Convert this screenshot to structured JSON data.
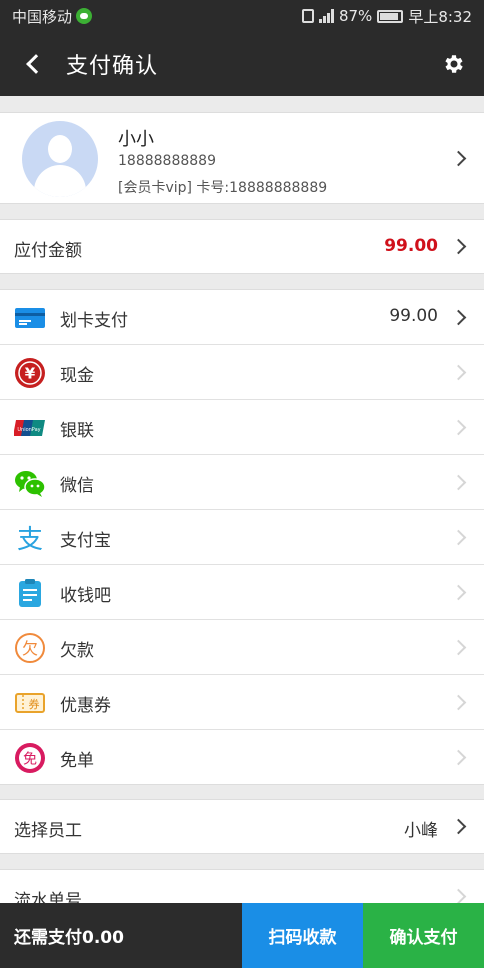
{
  "status_bar": {
    "carrier": "中国移动",
    "battery": "87%",
    "time": "早上8:32"
  },
  "header": {
    "title": "支付确认"
  },
  "member": {
    "name": "小小",
    "phone": "18888888889",
    "card_info": "[会员卡vip] 卡号:18888888889"
  },
  "amount_due": {
    "label": "应付金额",
    "value": "99.00",
    "color": "#d0111b"
  },
  "payment_methods": [
    {
      "label": "划卡支付",
      "value": "99.00",
      "icon": "card-icon"
    },
    {
      "label": "现金",
      "value": "",
      "icon": "cash-yen-icon"
    },
    {
      "label": "银联",
      "value": "",
      "icon": "unionpay-icon"
    },
    {
      "label": "微信",
      "value": "",
      "icon": "wechat-icon"
    },
    {
      "label": "支付宝",
      "value": "",
      "icon": "alipay-icon"
    },
    {
      "label": "收钱吧",
      "value": "",
      "icon": "clipboard-icon"
    },
    {
      "label": "欠款",
      "value": "",
      "icon": "debt-icon"
    },
    {
      "label": "优惠券",
      "value": "",
      "icon": "coupon-icon"
    },
    {
      "label": "免单",
      "value": "",
      "icon": "free-order-icon"
    }
  ],
  "icon_text": {
    "cash": "¥",
    "debt": "欠",
    "coupon": "券",
    "free": "免",
    "alipay": "支",
    "unionpay": "UnionPay"
  },
  "staff": {
    "label": "选择员工",
    "value": "小峰"
  },
  "serial": {
    "label": "流水单号"
  },
  "bottom_bar": {
    "remaining": "还需支付0.00",
    "scan_label": "扫码收款",
    "confirm_label": "确认支付",
    "scan_color": "#1a8ee6",
    "confirm_color": "#2ab246"
  }
}
